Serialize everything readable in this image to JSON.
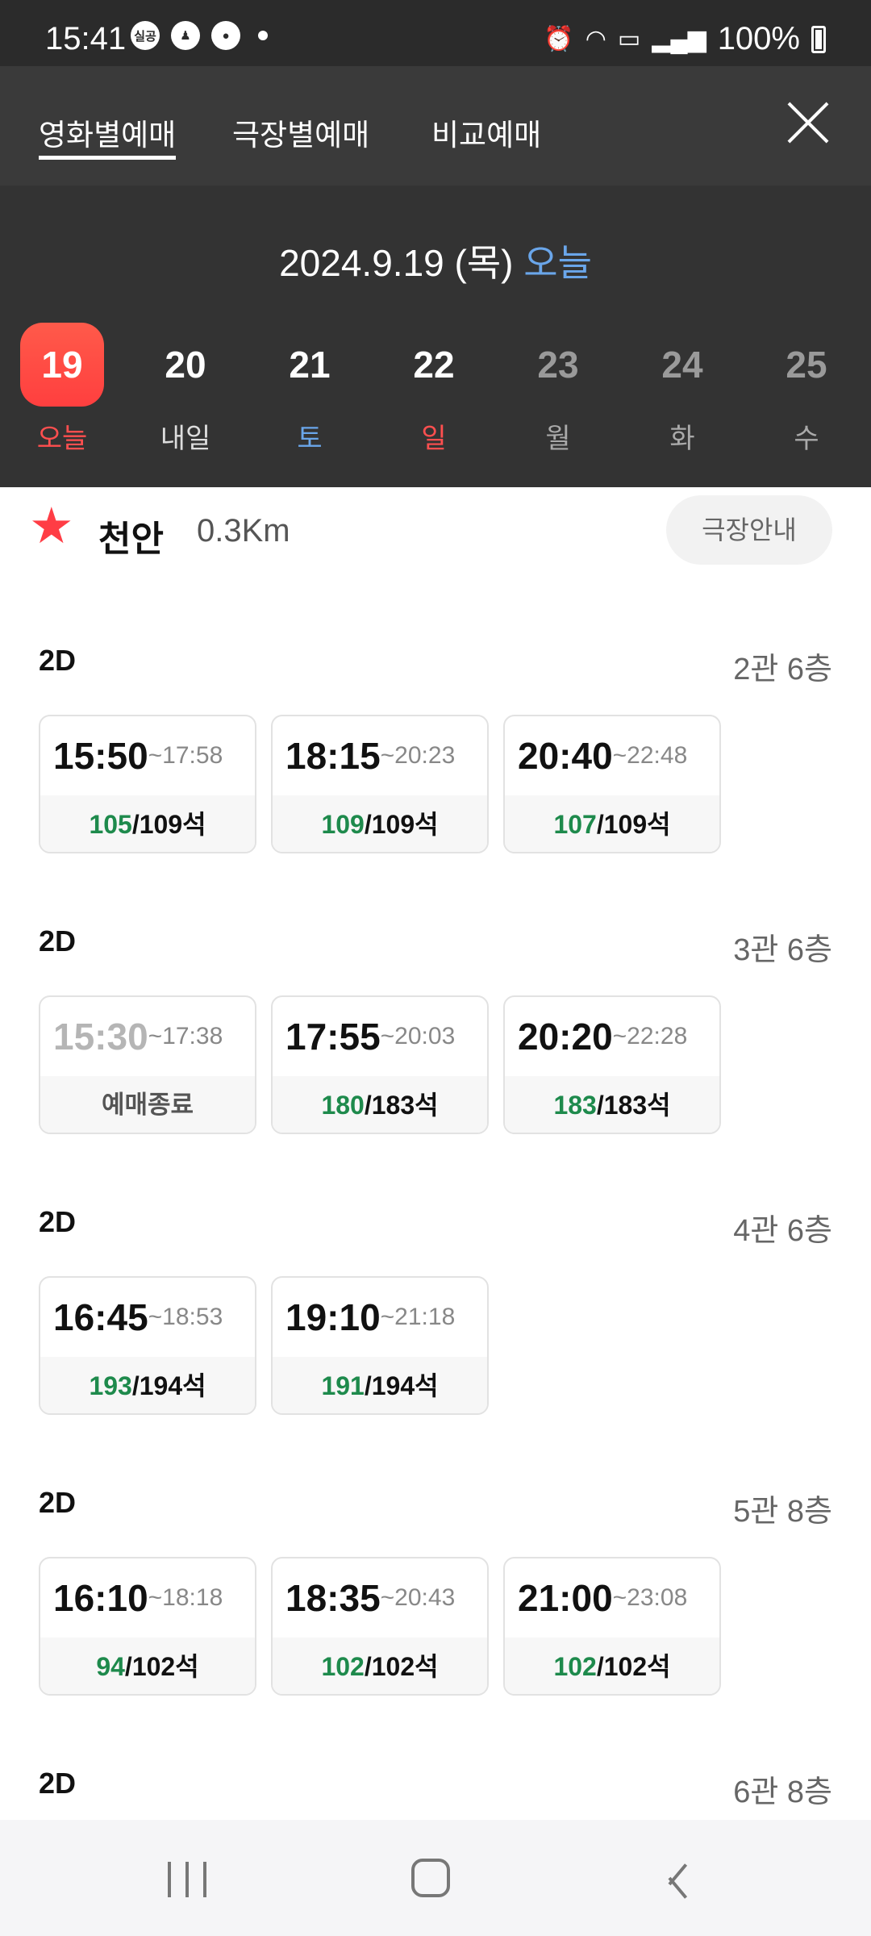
{
  "status_bar": {
    "time": "15:41",
    "left_icons": [
      {
        "icon": "notification-badge-icon",
        "text": "실공"
      },
      {
        "icon": "app-notification-icon",
        "text": ""
      },
      {
        "icon": "chat-bubble-icon",
        "text": ""
      }
    ],
    "battery": "100%"
  },
  "tabs": [
    {
      "label": "영화별예매",
      "active": true
    },
    {
      "label": "극장별예매",
      "active": false
    },
    {
      "label": "비교예매",
      "active": false
    }
  ],
  "date_header": {
    "date": "2024.9.19 (목)",
    "today_label": "오늘"
  },
  "dates": [
    {
      "day": "19",
      "label": "오늘",
      "selected": true,
      "style": "red"
    },
    {
      "day": "20",
      "label": "내일",
      "selected": false,
      "style": "normal"
    },
    {
      "day": "21",
      "label": "토",
      "selected": false,
      "style": "blue"
    },
    {
      "day": "22",
      "label": "일",
      "selected": false,
      "style": "red"
    },
    {
      "day": "23",
      "label": "월",
      "selected": false,
      "style": "dim"
    },
    {
      "day": "24",
      "label": "화",
      "selected": false,
      "style": "dim"
    },
    {
      "day": "25",
      "label": "수",
      "selected": false,
      "style": "dim"
    }
  ],
  "theater": {
    "name": "천안",
    "distance": "0.3Km",
    "guide_button": "극장안내"
  },
  "sections": [
    {
      "format": "2D",
      "hall": "2관 6층",
      "shows": [
        {
          "start": "15:50",
          "end": "~17:58",
          "available": "105",
          "total": "/109석"
        },
        {
          "start": "18:15",
          "end": "~20:23",
          "available": "109",
          "total": "/109석"
        },
        {
          "start": "20:40",
          "end": "~22:48",
          "available": "107",
          "total": "/109석"
        }
      ]
    },
    {
      "format": "2D",
      "hall": "3관 6층",
      "shows": [
        {
          "start": "15:30",
          "end": "~17:38",
          "status": "예매종료"
        },
        {
          "start": "17:55",
          "end": "~20:03",
          "available": "180",
          "total": "/183석"
        },
        {
          "start": "20:20",
          "end": "~22:28",
          "available": "183",
          "total": "/183석"
        }
      ]
    },
    {
      "format": "2D",
      "hall": "4관 6층",
      "shows": [
        {
          "start": "16:45",
          "end": "~18:53",
          "available": "193",
          "total": "/194석"
        },
        {
          "start": "19:10",
          "end": "~21:18",
          "available": "191",
          "total": "/194석"
        }
      ]
    },
    {
      "format": "2D",
      "hall": "5관 8층",
      "shows": [
        {
          "start": "16:10",
          "end": "~18:18",
          "available": "94",
          "total": "/102석"
        },
        {
          "start": "18:35",
          "end": "~20:43",
          "available": "102",
          "total": "/102석"
        },
        {
          "start": "21:00",
          "end": "~23:08",
          "available": "102",
          "total": "/102석"
        }
      ]
    },
    {
      "format": "2D",
      "hall": "6관 8층",
      "shows": []
    }
  ],
  "colors": {
    "header_bg": "#333333",
    "selected_date": "#ff4a45",
    "today_blue": "#6aa6ea",
    "seats_green": "#1e8a4c",
    "star_red": "#ff3d45"
  }
}
